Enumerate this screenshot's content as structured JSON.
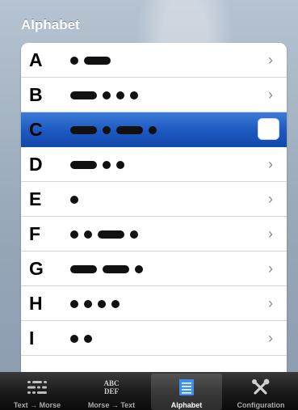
{
  "header": {
    "title": "Alphabet"
  },
  "rows": [
    {
      "letter": "A",
      "code": ".-"
    },
    {
      "letter": "B",
      "code": "-..."
    },
    {
      "letter": "C",
      "code": "-.-.",
      "selected": true
    },
    {
      "letter": "D",
      "code": "-.."
    },
    {
      "letter": "E",
      "code": "."
    },
    {
      "letter": "F",
      "code": "..-."
    },
    {
      "letter": "G",
      "code": "--."
    },
    {
      "letter": "H",
      "code": "...."
    },
    {
      "letter": "I",
      "code": ".."
    }
  ],
  "chevron_glyph": "›",
  "tabs": [
    {
      "label": "Text → Morse",
      "icon": "morse-lines-icon"
    },
    {
      "label": "Morse → Text",
      "icon": "abc-def-icon",
      "icon_text_1": "ABC",
      "icon_text_2": "DEF"
    },
    {
      "label": "Alphabet",
      "icon": "list-icon",
      "active": true
    },
    {
      "label": "Configuration",
      "icon": "tools-icon"
    }
  ],
  "colors": {
    "selected": "#1c58bf",
    "tabbar": "#1b1b1b",
    "active_icon": "#3b8ff0"
  }
}
